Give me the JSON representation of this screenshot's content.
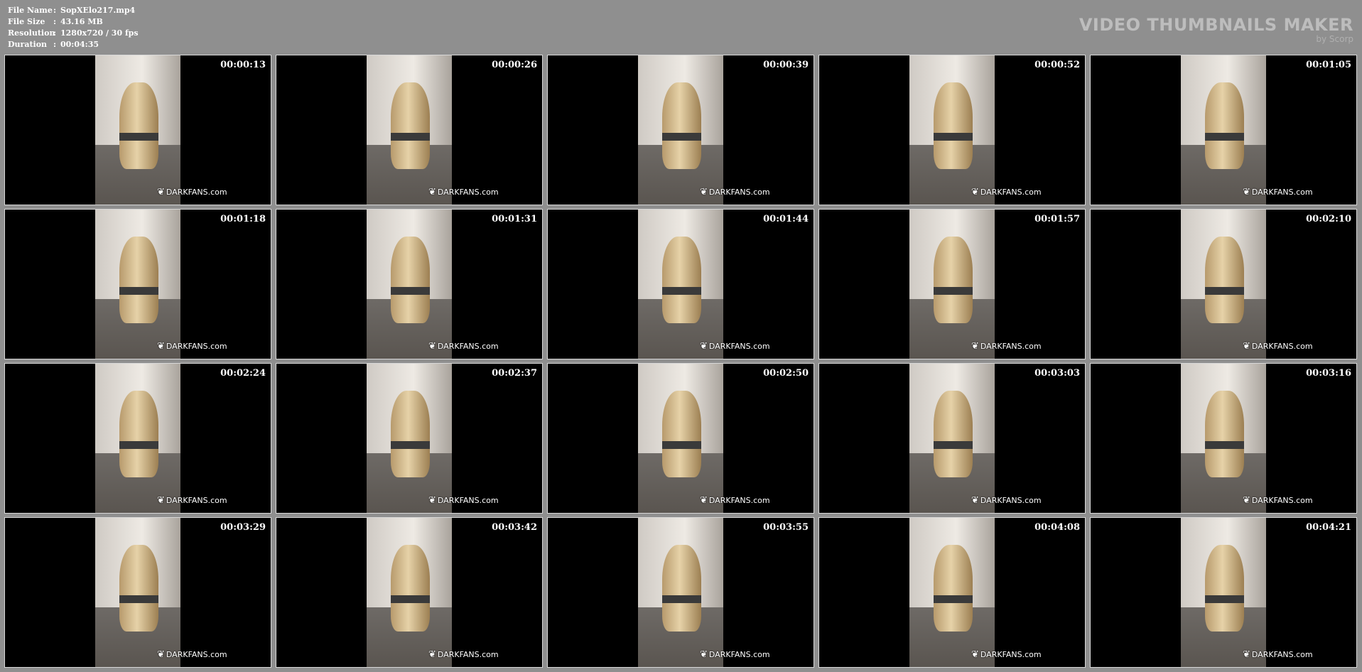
{
  "file_info": {
    "rows": [
      {
        "label": "File Name",
        "sep": ":",
        "value": "SopXElo217.mp4"
      },
      {
        "label": "File Size",
        "sep": ":",
        "value": "43.16 MB"
      },
      {
        "label": "Resolution",
        "sep": ":",
        "value": "1280x720 / 30 fps"
      },
      {
        "label": "Duration",
        "sep": ":",
        "value": "00:04:35"
      }
    ]
  },
  "brand": {
    "title": "VIDEO THUMBNAILS MAKER",
    "subtitle": "by Scorp"
  },
  "thumbnails": [
    {
      "time": "00:00:13",
      "watermark": "DARKFANS.com"
    },
    {
      "time": "00:00:26",
      "watermark": "DARKFANS.com"
    },
    {
      "time": "00:00:39",
      "watermark": "DARKFANS.com"
    },
    {
      "time": "00:00:52",
      "watermark": "DARKFANS.com"
    },
    {
      "time": "00:01:05",
      "watermark": "DARKFANS.com"
    },
    {
      "time": "00:01:18",
      "watermark": "DARKFANS.com"
    },
    {
      "time": "00:01:31",
      "watermark": "DARKFANS.com"
    },
    {
      "time": "00:01:44",
      "watermark": "DARKFANS.com"
    },
    {
      "time": "00:01:57",
      "watermark": "DARKFANS.com"
    },
    {
      "time": "00:02:10",
      "watermark": "DARKFANS.com"
    },
    {
      "time": "00:02:24",
      "watermark": "DARKFANS.com"
    },
    {
      "time": "00:02:37",
      "watermark": "DARKFANS.com"
    },
    {
      "time": "00:02:50",
      "watermark": "DARKFANS.com"
    },
    {
      "time": "00:03:03",
      "watermark": "DARKFANS.com"
    },
    {
      "time": "00:03:16",
      "watermark": "DARKFANS.com"
    },
    {
      "time": "00:03:29",
      "watermark": "DARKFANS.com"
    },
    {
      "time": "00:03:42",
      "watermark": "DARKFANS.com"
    },
    {
      "time": "00:03:55",
      "watermark": "DARKFANS.com"
    },
    {
      "time": "00:04:08",
      "watermark": "DARKFANS.com"
    },
    {
      "time": "00:04:21",
      "watermark": "DARKFANS.com"
    }
  ],
  "watermark_icon": "mask-icon"
}
